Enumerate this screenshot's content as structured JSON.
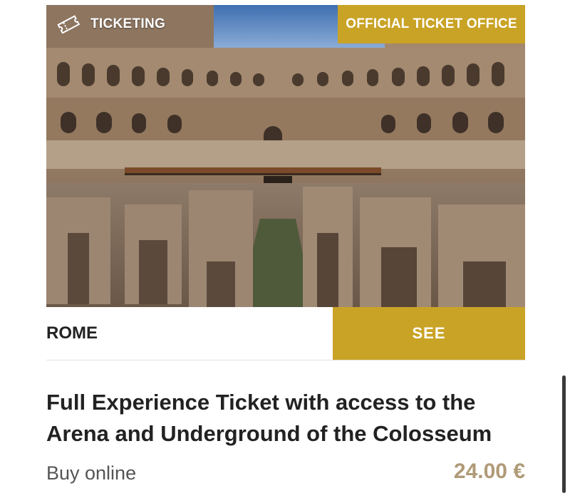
{
  "card": {
    "image_alt": "Colosseum arena and underground",
    "category_label": "TICKETING",
    "category_icon": "ticket-icon",
    "badge_label": "OFFICIAL TICKET OFFICE",
    "city": "ROME",
    "see_label": "SEE",
    "title": "Full Experience Ticket with access to the Arena and Underground of the Colosseum",
    "buy_text": "Buy online",
    "price": "24.00 €"
  },
  "colors": {
    "accent": "#c9a326",
    "price": "#b09a77",
    "text": "#222222"
  }
}
